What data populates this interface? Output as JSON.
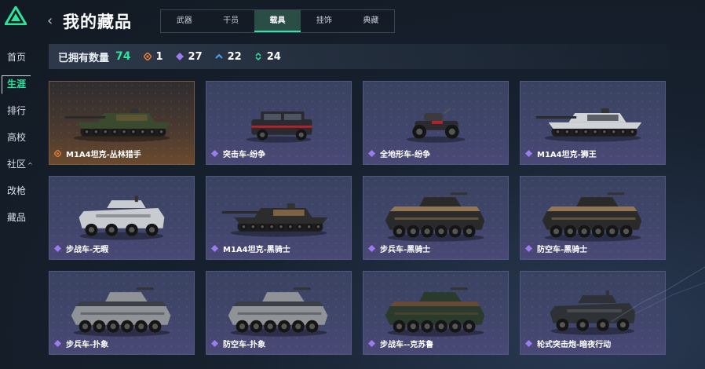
{
  "nav": {
    "items": [
      {
        "label": "首页",
        "active": false,
        "caret": ""
      },
      {
        "label": "生涯",
        "active": true,
        "caret": ""
      },
      {
        "label": "排行",
        "active": false,
        "caret": ""
      },
      {
        "label": "高校",
        "active": false,
        "caret": ""
      },
      {
        "label": "社区",
        "active": false,
        "caret": "^"
      },
      {
        "label": "改枪",
        "active": false,
        "caret": ""
      },
      {
        "label": "藏品",
        "active": false,
        "caret": ""
      }
    ]
  },
  "header": {
    "back_icon": "chevron-left-icon",
    "title": "我的藏品"
  },
  "tabs": [
    {
      "label": "武器",
      "active": false
    },
    {
      "label": "干员",
      "active": false
    },
    {
      "label": "载具",
      "active": true
    },
    {
      "label": "挂饰",
      "active": false
    },
    {
      "label": "典藏",
      "active": false
    }
  ],
  "stats": {
    "label": "已拥有数量",
    "total": "74",
    "counts": [
      {
        "icon": "orange-diamond-icon",
        "color": "#e07a3a",
        "value": "1"
      },
      {
        "icon": "purple-diamond-icon",
        "color": "#9b7cf0",
        "value": "27"
      },
      {
        "icon": "blue-chevron-icon",
        "color": "#4aa3f0",
        "value": "22"
      },
      {
        "icon": "green-arrows-icon",
        "color": "#34d39a",
        "value": "24"
      }
    ]
  },
  "colors": {
    "accent": "#2ee39a",
    "orange_rarity": "#e07a3a",
    "purple_rarity": "#9b7cf0"
  },
  "vehicles": [
    {
      "name": "M1A4坦克-丛林猎手",
      "rarity": "orange",
      "kind": "tank",
      "body": "#3b4a2e",
      "accent": "#6b5a36"
    },
    {
      "name": "突击车-纷争",
      "rarity": "purple",
      "kind": "suv",
      "body": "#2a2a30",
      "accent": "#b0232a"
    },
    {
      "name": "全地形车-纷争",
      "rarity": "purple",
      "kind": "atv",
      "body": "#2a2a30",
      "accent": "#b0232a"
    },
    {
      "name": "M1A4坦克-狮王",
      "rarity": "purple",
      "kind": "tank",
      "body": "#cfd2d6",
      "accent": "#2b2f36"
    },
    {
      "name": "步战车-无暇",
      "rarity": "purple",
      "kind": "apc-small",
      "body": "#c8cbcf",
      "accent": "#6a6d72"
    },
    {
      "name": "M1A4坦克-黑骑士",
      "rarity": "purple",
      "kind": "tank",
      "body": "#2d2c2c",
      "accent": "#a07a4e"
    },
    {
      "name": "步兵车-黑骑士",
      "rarity": "purple",
      "kind": "apc",
      "body": "#2a2a2a",
      "accent": "#9a7a52"
    },
    {
      "name": "防空车-黑骑士",
      "rarity": "purple",
      "kind": "apc",
      "body": "#2a2a2a",
      "accent": "#9a7a52"
    },
    {
      "name": "步兵车-扑象",
      "rarity": "purple",
      "kind": "apc",
      "body": "#8f9398",
      "accent": "#3a3d42"
    },
    {
      "name": "防空车-扑象",
      "rarity": "purple",
      "kind": "apc",
      "body": "#8f9398",
      "accent": "#3a3d42"
    },
    {
      "name": "步战车--克苏鲁",
      "rarity": "purple",
      "kind": "apc",
      "body": "#2a3a2c",
      "accent": "#6a4a32"
    },
    {
      "name": "轮式突击炮-暗夜行动",
      "rarity": "purple",
      "kind": "apc-small",
      "body": "#2e3236",
      "accent": "#5a5e64"
    }
  ]
}
